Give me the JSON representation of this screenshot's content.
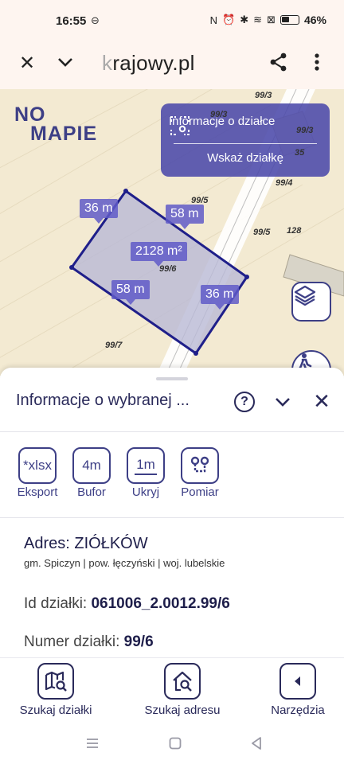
{
  "status": {
    "time": "16:55",
    "battery": "46%"
  },
  "browser": {
    "url_fade": "k",
    "url": "rajowy.pl"
  },
  "map": {
    "logo_line1": "NO",
    "logo_line2": "MAPIE",
    "info_panel": {
      "top_label": "Informacje o działce",
      "bottom_label": "Wskaż działkę"
    },
    "labels": {
      "side_left": "36 m",
      "side_top": "58 m",
      "area": "2128 m²",
      "side_bottom": "58 m",
      "side_right": "36 m"
    },
    "parcel_numbers": [
      "99/3",
      "99/3",
      "99/3",
      "35",
      "99/4",
      "99/5",
      "99/5",
      "128",
      "99/6",
      "99/7"
    ]
  },
  "sheet": {
    "title": "Informacje o wybranej ...",
    "help": "?",
    "tools": [
      {
        "icon_text": "*xlsx",
        "label": "Eksport"
      },
      {
        "icon_text": "4m",
        "label": "Bufor"
      },
      {
        "icon_text": "1m",
        "label": "Ukryj"
      },
      {
        "icon_text": "",
        "label": "Pomiar"
      }
    ],
    "address_label": "Adres:",
    "address_value": "ZIÓŁKÓW",
    "address_sub": "gm. Spiczyn | pow. łęczyński | woj. lubelskie",
    "id_label": "Id działki:",
    "id_value": "061006_2.0012.99/6",
    "number_label": "Numer działki:",
    "number_value": "99/6"
  },
  "bottom_nav": [
    {
      "label": "Szukaj działki",
      "icon": "map-search-icon"
    },
    {
      "label": "Szukaj adresu",
      "icon": "home-search-icon"
    },
    {
      "label": "Narzędzia",
      "icon": "chevron-left-icon"
    }
  ],
  "colors": {
    "brand": "#3d3f86",
    "panel": "#4b49aa",
    "parcel_fill": "#b9b9d6",
    "map_bg": "#f3ead2"
  }
}
